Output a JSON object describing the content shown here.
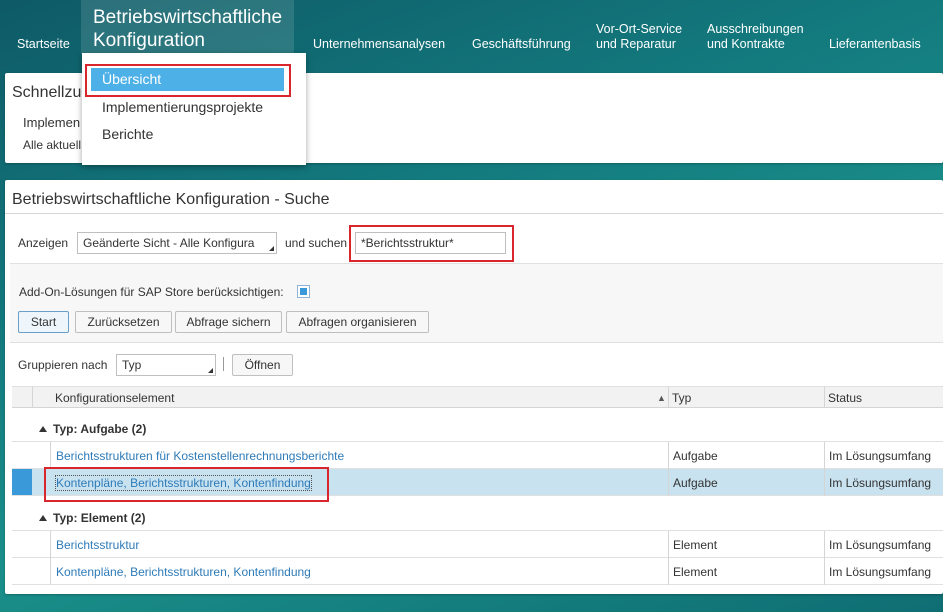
{
  "topnav": {
    "items": [
      {
        "label": "Startseite"
      },
      {
        "label": "Betriebswirtschaftliche Konfiguration"
      },
      {
        "label": "Unternehmensanalysen"
      },
      {
        "label": "Geschäftsführung"
      },
      {
        "label": "Vor-Ort-Service und Reparatur"
      },
      {
        "label": "Ausschreibungen und Kontrakte"
      },
      {
        "label": "Lieferantenbasis"
      }
    ],
    "active_line1": "Betriebswirtschaftliche",
    "active_line2": "Konfiguration",
    "vor_line1": "Vor-Ort-Service",
    "vor_line2": "und Reparatur",
    "aus_line1": "Ausschreibungen",
    "aus_line2": "und Kontrakte"
  },
  "menu": {
    "items": [
      "Übersicht",
      "Implementierungsprojekte",
      "Berichte"
    ]
  },
  "quick": {
    "title": "Schnellzu",
    "line": "Implemen",
    "link": "Alle aktuell"
  },
  "search": {
    "title": "Betriebswirtschaftliche Konfiguration - Suche",
    "show_label": "Anzeigen",
    "show_value": "Geänderte Sicht - Alle Konfigura",
    "and_search": "und suchen",
    "search_value": "*Berichtsstruktur*",
    "addon_label": "Add-On-Lösungen für SAP Store berücksichtigen:",
    "buttons": {
      "start": "Start",
      "reset": "Zurücksetzen",
      "save": "Abfrage sichern",
      "organize": "Abfragen organisieren"
    },
    "group_label": "Gruppieren nach",
    "group_value": "Typ",
    "open": "Öffnen"
  },
  "table": {
    "headers": [
      "Konfigurationselement",
      "Typ",
      "Status"
    ],
    "groups": [
      {
        "label": "Typ: Aufgabe (2)",
        "rows": [
          {
            "name": "Berichtsstrukturen für Kostenstellenrechnungsberichte",
            "type": "Aufgabe",
            "status": "Im Lösungsumfang"
          },
          {
            "name": "Kontenpläne, Berichtsstrukturen, Kontenfindung",
            "type": "Aufgabe",
            "status": "Im Lösungsumfang"
          }
        ]
      },
      {
        "label": "Typ: Element (2)",
        "rows": [
          {
            "name": "Berichtsstruktur",
            "type": "Element",
            "status": "Im Lösungsumfang"
          },
          {
            "name": "Kontenpläne, Berichtsstrukturen, Kontenfindung",
            "type": "Element",
            "status": "Im Lösungsumfang"
          }
        ]
      }
    ]
  },
  "colors": {
    "accent": "#3a9ad9",
    "highlight_box": "#d9262c",
    "link": "#2e7bb8"
  }
}
